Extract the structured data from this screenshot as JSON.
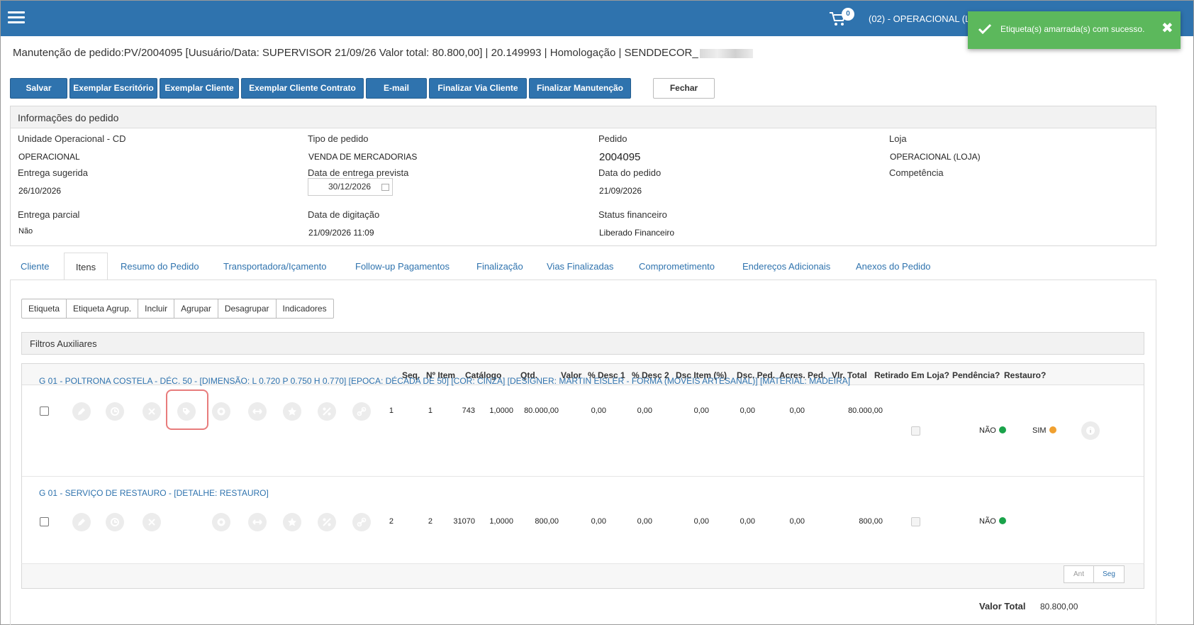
{
  "topbar": {
    "cart_count": "0",
    "unit_label": "(02) - OPERACIONAL (L"
  },
  "toast": {
    "message": "Etiqueta(s) amarrada(s) com sucesso.",
    "close": "✖"
  },
  "page_title": "Manutenção de pedido:PV/2004095 [Uusuário/Data: SUPERVISOR 21/09/26 Valor total: 80.800,00] | 20.149993 | Homologação | SENDDECOR_",
  "actions": {
    "salvar": "Salvar",
    "exemplar_escritorio": "Exemplar Escritório",
    "exemplar_cliente": "Exemplar Cliente",
    "exemplar_cliente_contrato": "Exemplar Cliente Contrato",
    "email": "E-mail",
    "finalizar_via_cliente": "Finalizar Via Cliente",
    "finalizar_manutencao": "Finalizar Manutenção",
    "fechar": "Fechar"
  },
  "info": {
    "title": "Informações do pedido",
    "unidade_label": "Unidade Operacional - CD",
    "unidade_value": "OPERACIONAL",
    "tipo_label": "Tipo de pedido",
    "tipo_value": "VENDA DE MERCADORIAS",
    "pedido_label": "Pedido",
    "pedido_value": "2004095",
    "loja_label": "Loja",
    "loja_value": "OPERACIONAL (LOJA)",
    "entrega_sugerida_label": "Entrega sugerida",
    "entrega_sugerida_value": "26/10/2026",
    "entrega_prevista_label": "Data de entrega prevista",
    "entrega_prevista_value": "30/12/2026",
    "data_pedido_label": "Data do pedido",
    "data_pedido_value": "21/09/2026",
    "competencia_label": "Competência",
    "entrega_parcial_label": "Entrega parcial",
    "entrega_parcial_value": "Não",
    "digitacao_label": "Data de digitação",
    "digitacao_value": "21/09/2026 11:09",
    "status_fin_label": "Status financeiro",
    "status_fin_value": "Liberado Financeiro"
  },
  "tabs": [
    "Cliente",
    "Itens",
    "Resumo do Pedido",
    "Transportadora/Içamento",
    "Follow-up Pagamentos",
    "Finalização",
    "Vias Finalizadas",
    "Comprometimento",
    "Endereços Adicionais",
    "Anexos do Pedido"
  ],
  "subtoolbar": [
    "Etiqueta",
    "Etiqueta Agrup.",
    "Incluir",
    "Agrupar",
    "Desagrupar",
    "Indicadores"
  ],
  "filtros": "Filtros Auxiliares",
  "grid": {
    "headers": [
      "Seq.",
      "Nº Item",
      "Catálogo",
      "Qtd.",
      "Valor",
      "% Desc 1",
      "% Desc 2",
      "Dsc Item (%)",
      "Dsc. Ped.",
      "Acres. Ped.",
      "Vlr. Total",
      "Retirado Em Loja?",
      "Pendência?",
      "Restauro?"
    ],
    "rows": [
      {
        "title": "G 01 - POLTRONA COSTELA - DÉC. 50 - [DIMENSÃO: L 0.720 P 0.750 H 0.770] [EPOCA: DÉCADA DE 50] [COR: CINZA] [DESIGNER: MARTIN EISLER - FORMA (MÓVEIS ARTESANAL)] [MATERIAL: MADEIRA]",
        "seq": "1",
        "item": "1",
        "catalogo": "743",
        "qtd": "1,0000",
        "valor": "80.000,00",
        "desc1": "0,00",
        "desc2": "0,00",
        "dsc_item": "0,00",
        "dsc_ped": "0,00",
        "acres": "0,00",
        "total": "80.000,00",
        "pendencia": "NÃO",
        "restauro": "SIM"
      },
      {
        "title": "G 01 - SERVIÇO DE RESTAURO - [DETALHE: RESTAURO]",
        "seq": "2",
        "item": "2",
        "catalogo": "31070",
        "qtd": "1,0000",
        "valor": "800,00",
        "desc1": "0,00",
        "desc2": "0,00",
        "dsc_item": "0,00",
        "dsc_ped": "0,00",
        "acres": "0,00",
        "total": "800,00",
        "pendencia": "NÃO",
        "restauro": ""
      }
    ]
  },
  "pager": {
    "prev": "Ant",
    "next": "Seg"
  },
  "totals": {
    "label": "Valor Total",
    "value": "80.800,00"
  },
  "colors": {
    "primary": "#2f73ae",
    "success": "#5cb85c",
    "green_dot": "#1aa34a",
    "orange_dot": "#f0a030"
  }
}
